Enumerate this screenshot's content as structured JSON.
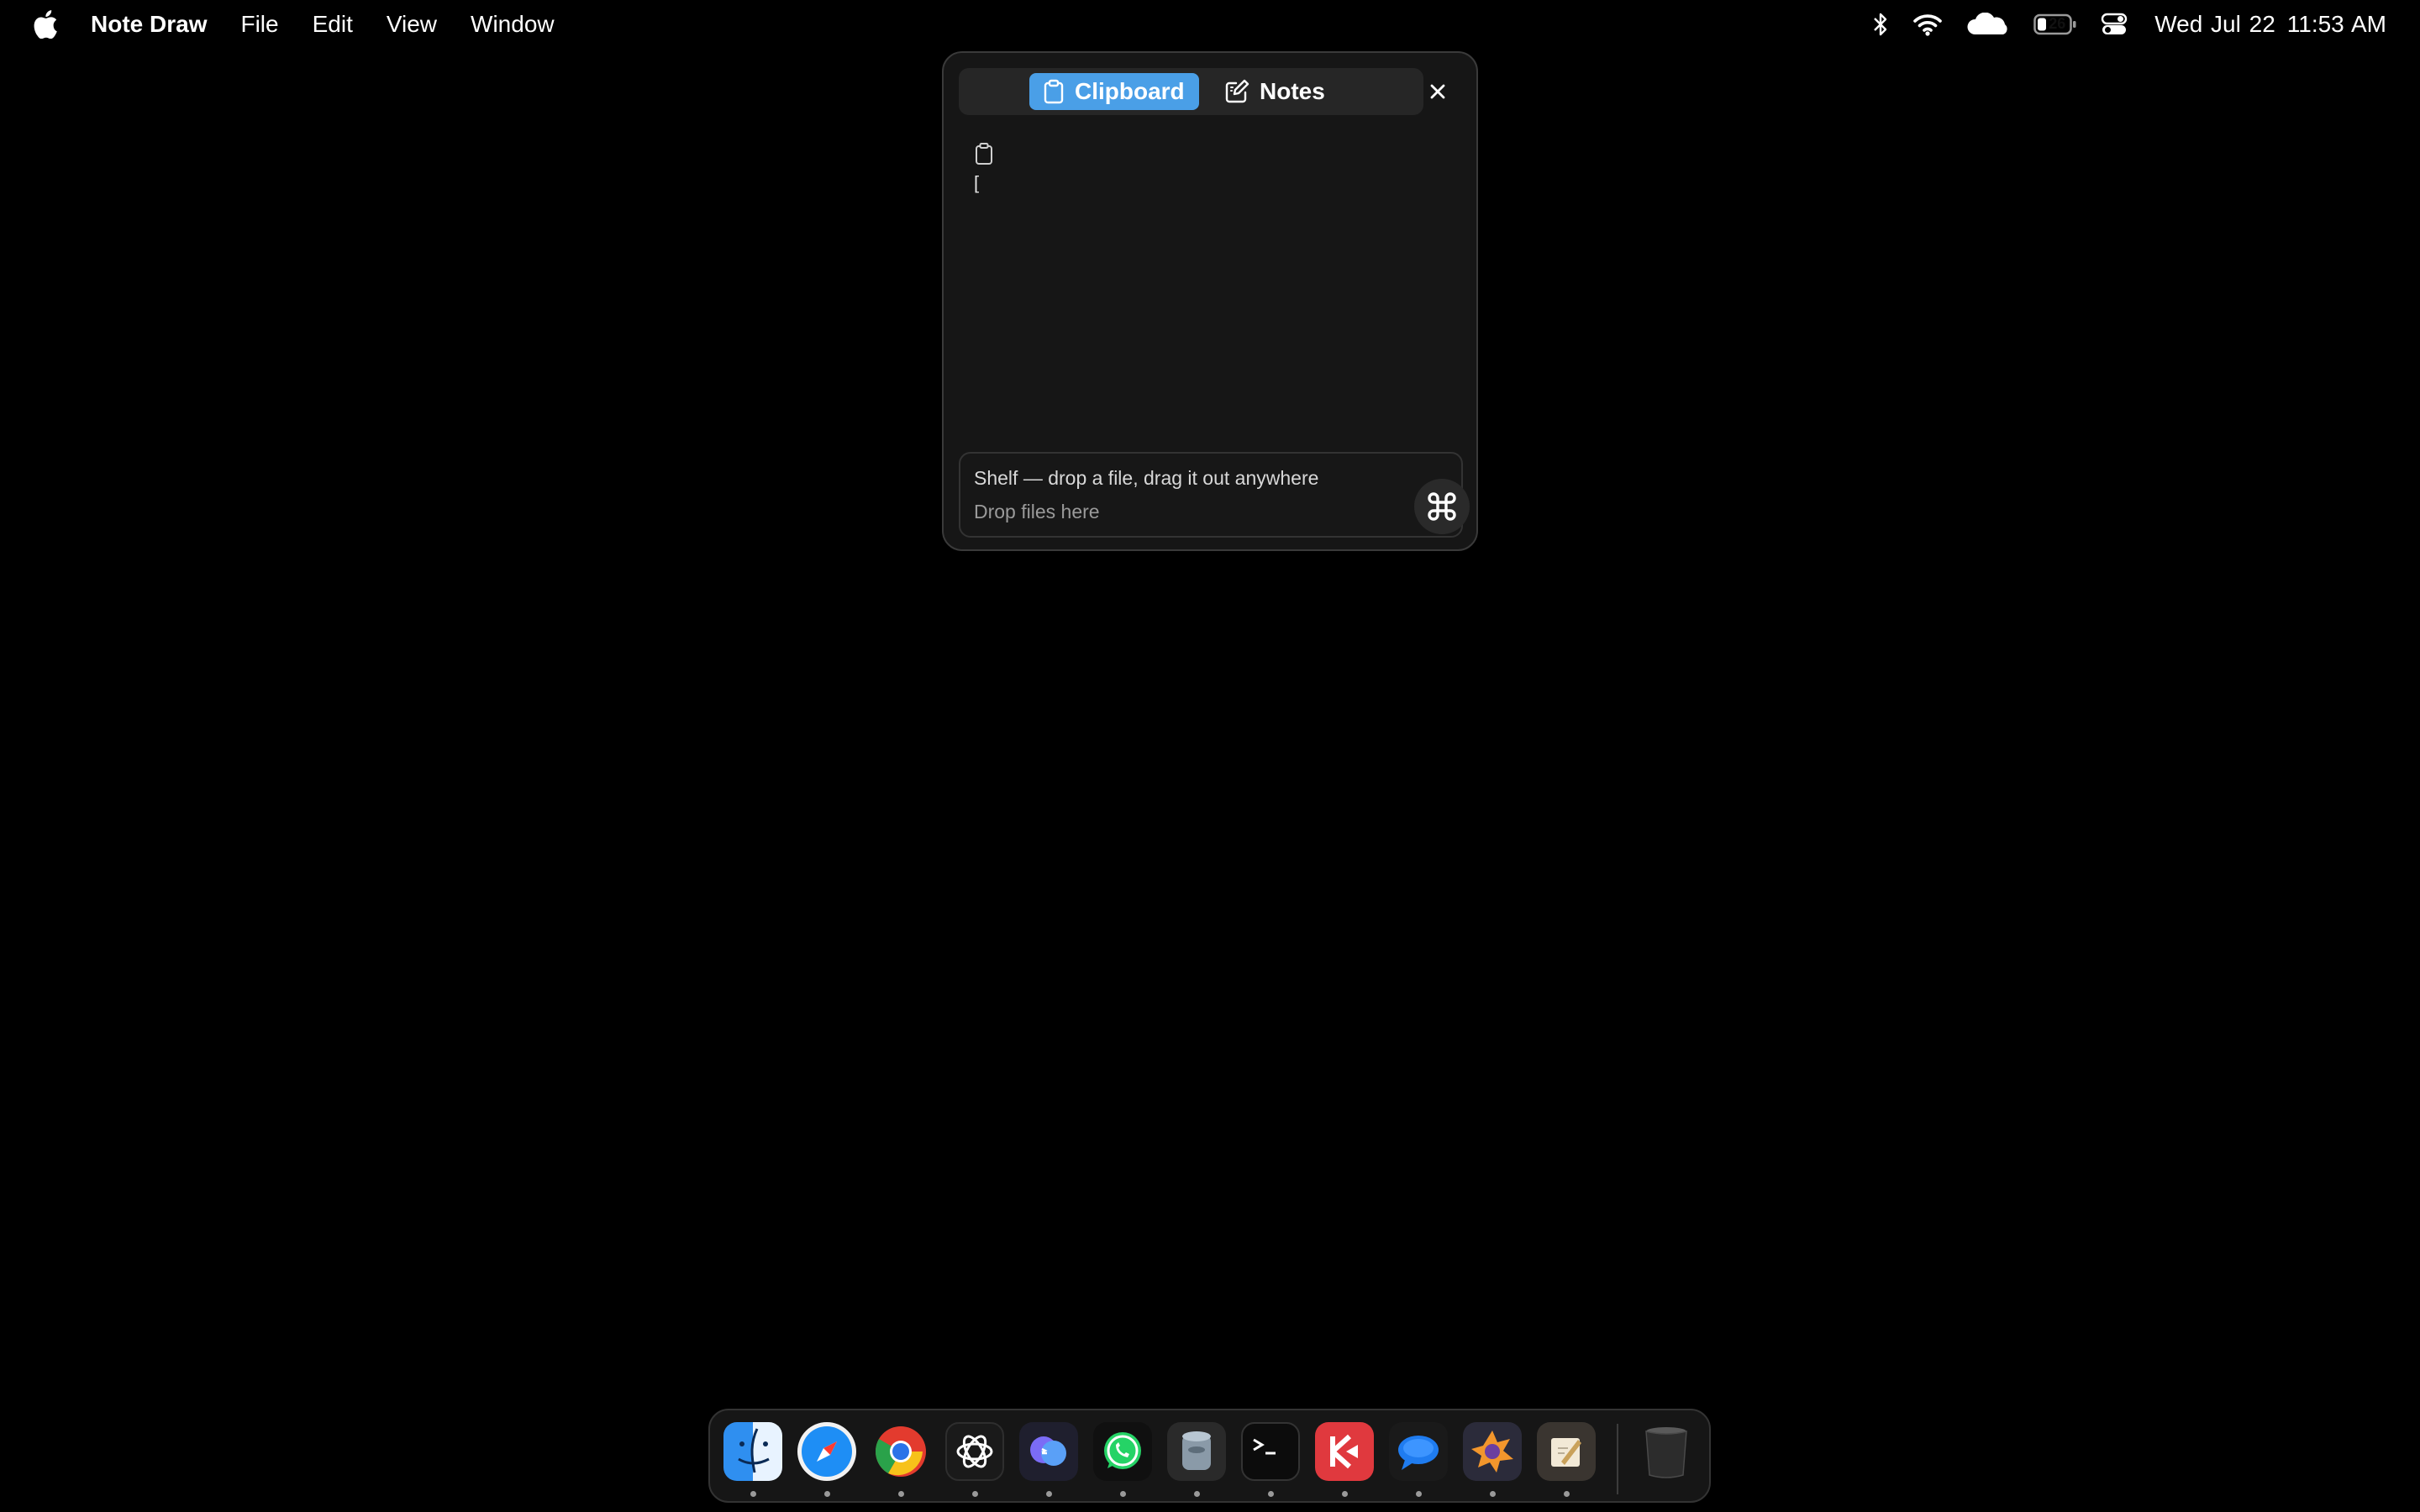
{
  "menubar": {
    "app_name": "Note Draw",
    "menus": [
      "File",
      "Edit",
      "View",
      "Window"
    ],
    "status_icons": [
      "bluetooth-icon",
      "wifi-icon",
      "cloud-icon",
      "battery-icon",
      "control-center-icon"
    ],
    "battery_level": "26",
    "date": "Wed Jul 22",
    "time": "11:53 AM"
  },
  "popover": {
    "tabs": [
      {
        "label": "Clipboard",
        "icon": "clipboard-icon",
        "active": true
      },
      {
        "label": "Notes",
        "icon": "note-edit-icon",
        "active": false
      }
    ],
    "close_icon": "close-icon",
    "clipboard_entry_text": "[",
    "shelf": {
      "title": "Shelf — drop a file, drag it out anywhere",
      "placeholder": "Drop files here",
      "button_icon": "command-icon"
    },
    "accent_color": "#4a9fe7"
  },
  "dock": {
    "apps": [
      "Finder",
      "Safari",
      "Chrome",
      "ChatGPT",
      "Copilot",
      "WhatsApp",
      "Disk Utility",
      "Terminal",
      "Klack",
      "Messages",
      "Sketch",
      "Notes Draw"
    ],
    "trash": "Trash"
  }
}
